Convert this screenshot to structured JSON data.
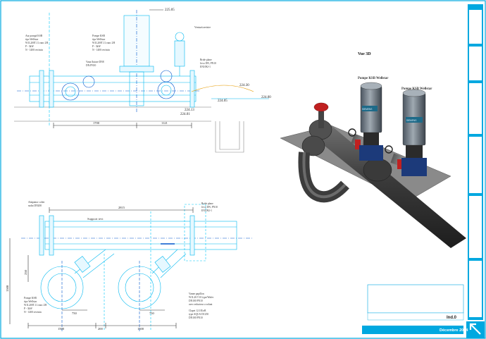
{
  "elevations": {
    "top": "225.05",
    "right_upper": "224.30",
    "right_lower": "224.05",
    "far_right": "224.00",
    "mid1": "224.13",
    "mid2": "224.01"
  },
  "elevation_view": {
    "dims": [
      "1700",
      "1121"
    ],
    "labels": {
      "pump_left": [
        "Aur pompă KSB",
        "tipo Wellstar",
        "W1L200T.11.vanc 2H",
        "P - 3kW",
        "N - 1400 rev/min"
      ],
      "pump_right": [
        "Pompe KSB",
        "tipo Wellstar",
        "W1L200T.11.vanc 2H",
        "P - 3kW",
        "N - 1400 rev/min"
      ],
      "valve": [
        "Vana fluture DN8",
        "DN.PN10"
      ],
      "top_right": [
        "Ventuză aerisire"
      ],
      "flange": [
        "Bride plane",
        "Jovo DN, PN10",
        "EN1092-1"
      ]
    }
  },
  "plan_view": {
    "overall_dim": "2815",
    "dims_bottom": [
      "1500",
      "200",
      "1500"
    ],
    "dims_inner": [
      "750",
      "750"
    ],
    "dim_left": "1500",
    "dim_side": "250",
    "labels": {
      "pipe": "Support tevi",
      "top_left": [
        "Adaptator colier",
        "sudat DN200"
      ],
      "flange": [
        "Bride plane",
        "Jovo DN, PN10",
        "EN1092-1"
      ],
      "pump": [
        "Pompe KSB",
        "tipo Wellstar",
        "W1L200T.11.vanc 2H",
        "P - 3kW",
        "N - 1400 rev/min"
      ],
      "check_valve": [
        "Vanne papillon",
        "W1L20.T.10 type/Wafer",
        "DN100 PN10",
        "avec reducteur a volant"
      ],
      "clapet": [
        "Clapet 12.10LeR",
        "type AQUA DI 250",
        "DN100 PN10"
      ]
    }
  },
  "view3d": {
    "title": "Vue 3D",
    "pump_left": "Pompe KSB Wellstar",
    "pump_right": "Pompe KSB Wellstar",
    "motor_brand": "SIEMENS"
  },
  "title_block": {
    "revision": "Ind.0",
    "date": "Décembre 2014"
  },
  "colors": {
    "cad": "#00b8f0",
    "cad_dark": "#0055cc",
    "accent": "#00a8e0",
    "pipe3d": "#3d3d3d",
    "pump_body": "#1c3a7a",
    "red_valve": "#c02020"
  },
  "icons": [
    "arrow-northwest-icon"
  ]
}
